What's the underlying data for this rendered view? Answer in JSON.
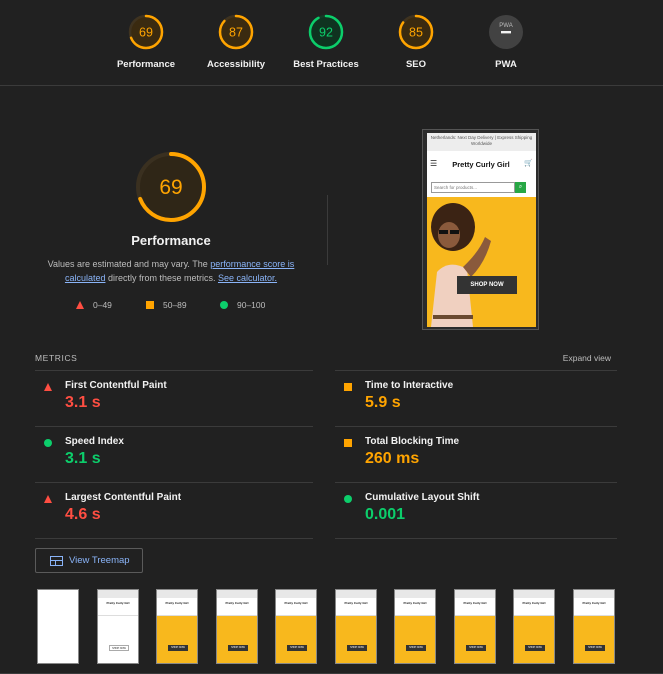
{
  "categories": [
    {
      "label": "Performance",
      "score": "69",
      "fraction": 0.69,
      "color": "#ffa400"
    },
    {
      "label": "Accessibility",
      "score": "87",
      "fraction": 0.87,
      "color": "#ffa400"
    },
    {
      "label": "Best Practices",
      "score": "92",
      "fraction": 0.92,
      "color": "#0cce6b"
    },
    {
      "label": "SEO",
      "score": "85",
      "fraction": 0.85,
      "color": "#ffa400"
    },
    {
      "label": "PWA",
      "badge": "PWA",
      "color": "#9e9e9e"
    }
  ],
  "performance": {
    "score": "69",
    "fraction": 0.69,
    "title": "Performance",
    "desc_part1": "Values are estimated and may vary. The ",
    "link1": "performance score is calculated",
    "desc_part2": " directly from these metrics. ",
    "link2": "See calculator."
  },
  "legend": [
    {
      "label": "0–49",
      "shape": "triangle",
      "color": "#ff4e42"
    },
    {
      "label": "50–89",
      "shape": "square",
      "color": "#ffa400"
    },
    {
      "label": "90–100",
      "shape": "circle",
      "color": "#0cce6b"
    }
  ],
  "screenshot": {
    "notice": "Netherlands: Next Day Delivery | Express Shipping Worldwide",
    "brand": "Pretty Curly Girl",
    "search_placeholder": "Search for products...",
    "cta": "SHOP NOW"
  },
  "metrics": {
    "heading": "METRICS",
    "expand": "Expand view",
    "items": [
      {
        "title": "First Contentful Paint",
        "value": "3.1 s",
        "rating": "red"
      },
      {
        "title": "Time to Interactive",
        "value": "5.9 s",
        "rating": "orange"
      },
      {
        "title": "Speed Index",
        "value": "3.1 s",
        "rating": "green"
      },
      {
        "title": "Total Blocking Time",
        "value": "260 ms",
        "rating": "orange"
      },
      {
        "title": "Largest Contentful Paint",
        "value": "4.6 s",
        "rating": "red"
      },
      {
        "title": "Cumulative Layout Shift",
        "value": "0.001",
        "rating": "green"
      }
    ]
  },
  "treemap_label": "View Treemap",
  "filmstrip": {
    "frame_brand": "Pretty Curly Girl",
    "frame_cta": "SHOP NOW",
    "frames": [
      "blank",
      "loading",
      "loaded",
      "loaded",
      "loaded",
      "loaded",
      "loaded",
      "loaded",
      "loaded",
      "loaded"
    ]
  }
}
